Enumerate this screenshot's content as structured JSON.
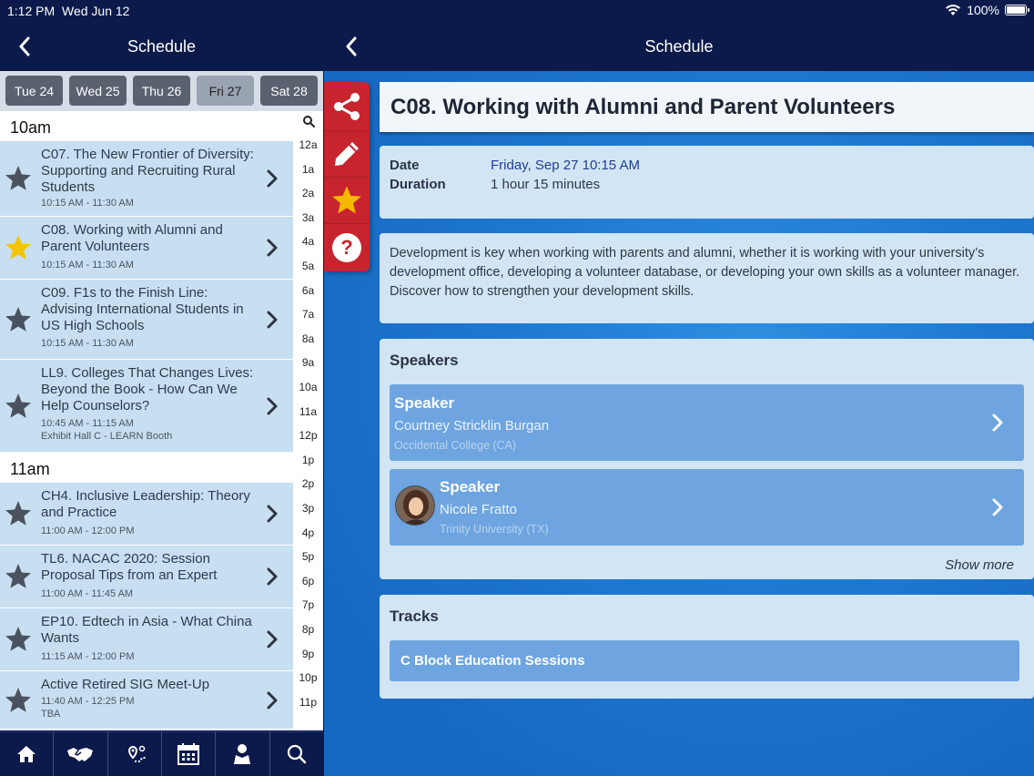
{
  "status_bar": {
    "time": "1:12 PM",
    "date": "Wed Jun 12",
    "battery": "100%",
    "battery_level": 1.0
  },
  "left": {
    "header_title": "Schedule",
    "day_tabs": [
      {
        "label": "Tue 24",
        "active": false
      },
      {
        "label": "Wed 25",
        "active": false
      },
      {
        "label": "Thu 26",
        "active": false
      },
      {
        "label": "Fri 27",
        "active": true
      },
      {
        "label": "Sat 28",
        "active": false
      }
    ],
    "time_headers": [
      "10am",
      "11am"
    ],
    "sessions": [
      {
        "title": "C07. The New Frontier of Diversity: Supporting and Recruiting Rural Students",
        "time": "10:15 AM - 11:30 AM",
        "location": "",
        "starred": false
      },
      {
        "title": "C08. Working with Alumni and Parent Volunteers",
        "time": "10:15 AM - 11:30 AM",
        "location": "",
        "starred": true
      },
      {
        "title": "C09. F1s to the Finish Line: Advising International Students in US High Schools",
        "time": "10:15 AM - 11:30 AM",
        "location": "",
        "starred": false
      },
      {
        "title": "LL9. Colleges That Changes Lives: Beyond the Book - How Can We Help Counselors?",
        "time": "10:45 AM - 11:15 AM",
        "location": "Exhibit Hall C - LEARN Booth",
        "starred": false
      },
      {
        "title": "CH4. Inclusive Leadership: Theory and Practice",
        "time": "11:00 AM - 12:00 PM",
        "location": "",
        "starred": false
      },
      {
        "title": "TL6. NACAC 2020: Session Proposal Tips from an Expert",
        "time": "11:00 AM - 11:45 AM",
        "location": "",
        "starred": false
      },
      {
        "title": "EP10. Edtech in Asia - What China Wants",
        "time": "11:15 AM - 12:00 PM",
        "location": "",
        "starred": false
      },
      {
        "title": "Active Retired SIG Meet-Up",
        "time": "11:40 AM - 12:25 PM",
        "location": "TBA",
        "starred": false
      }
    ],
    "hour_index": [
      "12a",
      "1a",
      "2a",
      "3a",
      "4a",
      "5a",
      "6a",
      "7a",
      "8a",
      "9a",
      "10a",
      "11a",
      "12p",
      "1p",
      "2p",
      "3p",
      "4p",
      "5p",
      "6p",
      "7p",
      "8p",
      "9p",
      "10p",
      "11p"
    ],
    "tab_bar": [
      "home-icon",
      "handshake-icon",
      "map-route-icon",
      "calendar-icon",
      "person-icon",
      "search-icon"
    ]
  },
  "right": {
    "header_title": "Schedule",
    "session_title": "C08. Working with Alumni and Parent Volunteers",
    "info": {
      "date_label": "Date",
      "date_value": "Friday, Sep 27 10:15 AM",
      "duration_label": "Duration",
      "duration_value": "1 hour 15 minutes"
    },
    "description": "Development is key when working with parents and alumni, whether it is working with your university’s development office, developing a volunteer database, or developing your own skills as a volunteer manager. Discover how to strengthen your development skills.",
    "speakers_title": "Speakers",
    "speakers": [
      {
        "role": "Speaker",
        "name": "Courtney Stricklin Burgan",
        "org": "Occidental College (CA)",
        "has_photo": false
      },
      {
        "role": "Speaker",
        "name": "Nicole Fratto",
        "org": "Trinity University (TX)",
        "has_photo": true
      }
    ],
    "show_more": "Show more",
    "tracks_title": "Tracks",
    "tracks": [
      "C Block Education Sessions"
    ]
  },
  "colors": {
    "navy": "#0b1a4a",
    "session_row": "#c7dff1",
    "accent_red": "#c8242e",
    "star_gold": "#f5b800",
    "card_blue": "#6ea5e0"
  }
}
